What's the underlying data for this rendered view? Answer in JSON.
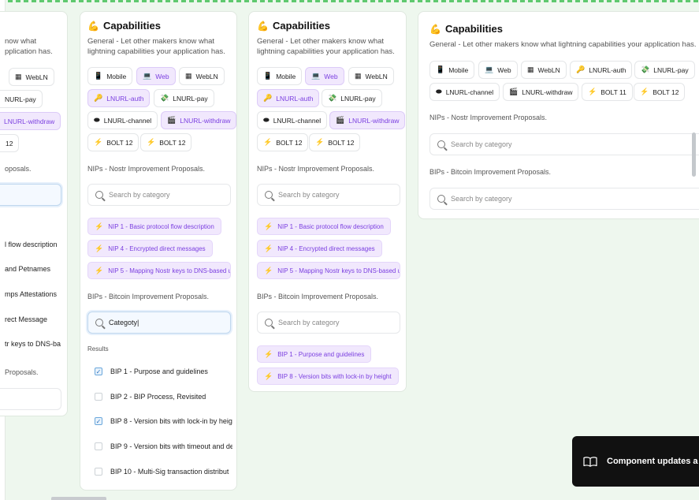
{
  "card": {
    "title": "Capabilities",
    "title_icon": "flexed-biceps-icon",
    "description": "General - Let other makers know what lightning capabilities your application has.",
    "nips_label": "NIPs - Nostr Improvement Proposals.",
    "bips_label": "BIPs - Bitcoin Improvement Proposals.",
    "search_placeholder": "Search by category",
    "results_label": "Results"
  },
  "chips": {
    "mobile": "Mobile",
    "web": "Web",
    "webln": "WebLN",
    "lnurl_auth": "LNURL-auth",
    "lnurl_pay": "LNURL-pay",
    "lnurl_channel": "LNURL-channel",
    "lnurl_withdraw": "LNURL-withdraw",
    "bolt11": "BOLT 11",
    "bolt12": "BOLT 12"
  },
  "chip_icons": {
    "mobile": "📱",
    "web": "💻",
    "webln": "▦",
    "lnurl_auth": "🔑",
    "lnurl_pay": "💸",
    "lnurl_channel": "⬬",
    "lnurl_withdraw": "🎬",
    "bolt": "⚡",
    "search": "magnifier-icon"
  },
  "nips": {
    "nip1": "NIP 1 - Basic protocol flow description",
    "nip4": "NIP 4 - Encrypted direct messages",
    "nip5": "NIP 5 - Mapping Nostr keys to DNS-based un"
  },
  "bips": {
    "bip1": "BIP 1 - Purpose and guidelines",
    "bip8": "BIP 8 - Version bits with lock-in by height"
  },
  "search_typed": "Categoty|",
  "results": [
    {
      "label": "BIP 1 - Purpose and guidelines",
      "checked": true
    },
    {
      "label": "BIP 2 - BIP Process, Revisited",
      "checked": false
    },
    {
      "label": "BIP 8 - Version bits with lock-in by heig",
      "checked": true
    },
    {
      "label": "BIP 9 - Version bits with timeout and de",
      "checked": false
    },
    {
      "label": "BIP 10 - Multi-Sig transaction distribut",
      "checked": false
    }
  ],
  "left_partial": {
    "desc1": "now what",
    "desc2": "pplication has.",
    "webln": "WebLN",
    "lnurl_pay": "NURL-pay",
    "lnurl_withdraw": "LNURL-withdraw",
    "bolt": "12",
    "nips_label": "oposals.",
    "items": [
      "l flow description",
      "and Petnames",
      "mps Attestations",
      "rect Message",
      "tr keys to DNS-ba"
    ],
    "proposals": "Proposals."
  },
  "toast": {
    "text": "Component updates a",
    "icon": "book-open-icon"
  },
  "colors": {
    "accent": "#7b3fe0",
    "chip_selected_bg": "#f1e8fd",
    "background": "#eef7ee"
  }
}
